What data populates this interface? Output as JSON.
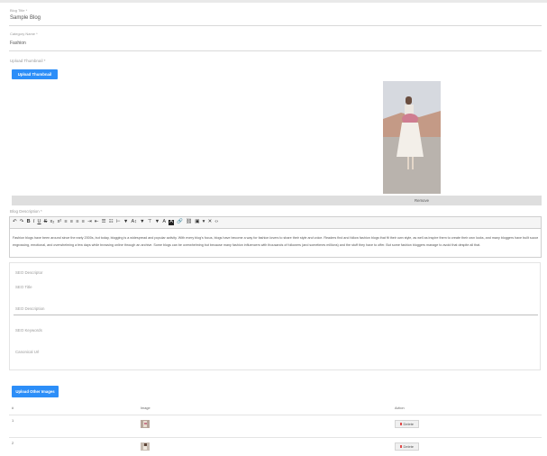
{
  "form": {
    "blog_title_label": "Blog Title *",
    "blog_title_value": "Sample Blog",
    "category_label": "Category Name *",
    "category_value": "Fashion",
    "thumbnail_label": "Upload Thumbnail *",
    "upload_thumbnail_button": "Upload Thumbnail",
    "remove_label": "Remove",
    "description_label": "Blog Description *"
  },
  "editor": {
    "toolbar_icons": [
      "undo-icon",
      "redo-icon",
      "bold-icon",
      "italic-icon",
      "underline-icon",
      "strikethrough-icon",
      "subscript-icon",
      "superscript-icon",
      "align-left-icon",
      "align-center-icon",
      "align-right-icon",
      "align-justify-icon",
      "indent-icon",
      "outdent-icon",
      "unordered-list-icon",
      "ordered-list-icon",
      "heading-icon",
      "paragraph-icon",
      "font-size-icon",
      "style-icon",
      "format-icon",
      "text-color-icon",
      "highlight-icon",
      "link-icon",
      "unlink-icon",
      "image-icon",
      "more-icon",
      "clear-icon",
      "code-icon"
    ],
    "line1": "Fashion blogs have been around since the early 2000s, but today, blogging is a widespread and popular activity. With every blog's focus, blogs have become a way for fashion lovers to share their style and voice. Readers find and follow fashion blogs that fit their own style, as well as inspire them to create their own looks, and many bloggers have built successful businesses in the industry.",
    "line2": "engrossing, emotional, and overwhelming a few days while browsing online through an archive. Some blogs can be overwhelming but because many fashion influencers with thousands of followers (and sometimes millions) and the stuff they have to offer. But some fashion bloggers manage to avoid that despite all that."
  },
  "seo": {
    "descriptor_label": "SEO Descriptor",
    "title_label": "SEO Title",
    "description_label": "SEO Description",
    "keywords_label": "SEO Keywords",
    "canonical_label": "Canonical Url"
  },
  "gallery": {
    "upload_button": "Upload Other Images",
    "columns": [
      "#",
      "Image",
      "Action"
    ],
    "rows": [
      {
        "num": "1",
        "action": "Delete"
      },
      {
        "num": "2",
        "action": "Delete"
      }
    ]
  }
}
